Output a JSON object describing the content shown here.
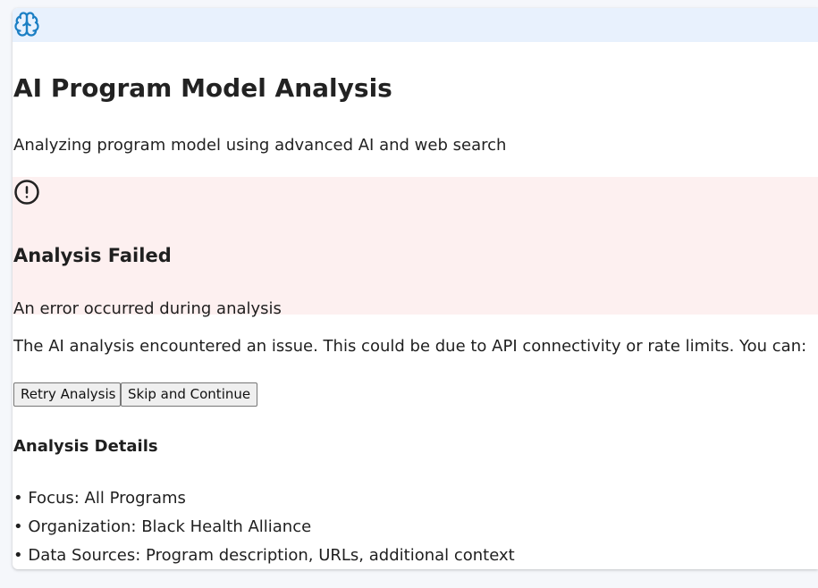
{
  "header": {
    "logo_icon": "brain-icon",
    "accent_color": "#1b7fc4"
  },
  "main": {
    "title": "AI Program Model Analysis",
    "subtitle": "Analyzing program model using advanced AI and web search"
  },
  "error": {
    "icon": "alert-circle-icon",
    "title": "Analysis Failed",
    "message": "An error occurred during analysis",
    "background_color": "#fdf0f0"
  },
  "explanation": "The AI analysis encountered an issue. This could be due to API connectivity or rate limits. You can:",
  "actions": {
    "retry_label": "Retry Analysis",
    "skip_label": "Skip and Continue"
  },
  "details": {
    "title": "Analysis Details",
    "items": [
      "• Focus: All Programs",
      "• Organization: Black Health Alliance",
      "• Data Sources: Program description, URLs, additional context"
    ]
  }
}
